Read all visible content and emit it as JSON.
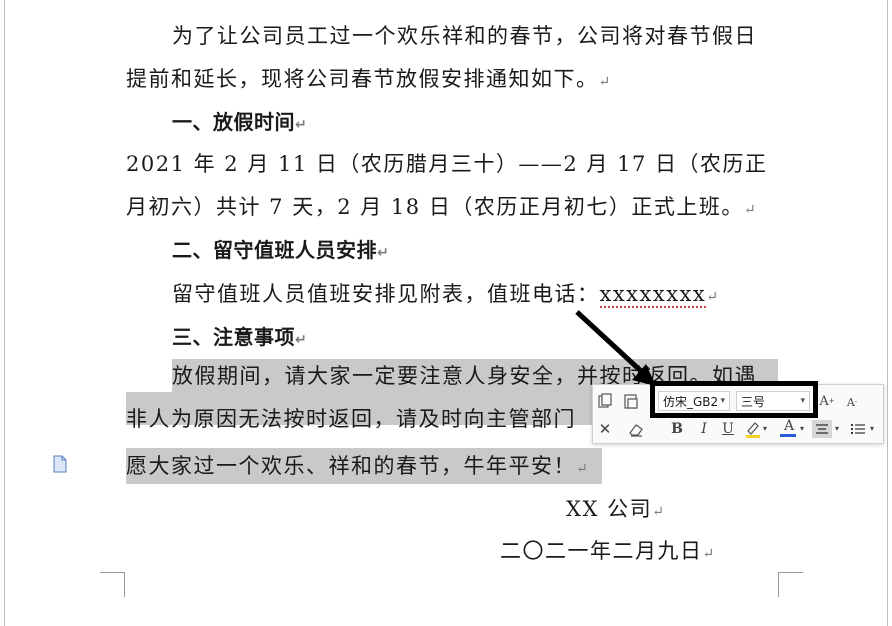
{
  "document": {
    "para1_line1": "为了让公司员工过一个欢乐祥和的春节，公司将对春节假日",
    "para1_line2": "提前和延长，现将公司春节放假安排通知如下。",
    "heading1": "一、放假时间",
    "para2_line1": "2021 年 2 月 11 日（农历腊月三十）——2 月 17 日（农历正",
    "para2_line2": "月初六）共计 7 天，2 月 18 日（农历正月初七）正式上班。",
    "heading2": "二、留守值班人员安排",
    "para3_prefix": "留守值班人员值班安排见附表，值班电话：",
    "para3_phone": "xxxxxxxx",
    "heading3": "三、注意事项",
    "para4_line1": "放假期间，请大家一定要注意人身安全，并按时返回。如遇",
    "para4_line2": "非人为原因无法按时返回，请及时向主管部门",
    "para4_line3": "愿大家过一个欢乐、祥和的春节，牛年平安！",
    "signature_company": "XX 公司",
    "signature_date": "二〇二一年二月九日",
    "paragraph_mark": "↵"
  },
  "toolbar": {
    "font_name": "仿宋_GB2",
    "font_size": "三号",
    "grow_font_label": "A",
    "shrink_font_label": "A",
    "bold_label": "B",
    "italic_label": "I",
    "underline_label": "U",
    "font_color_label": "A",
    "font_color": "#2b5bd7",
    "highlight_color": "#f0d020",
    "dropdown_arrow": "▾"
  },
  "colors": {
    "selection": "#c9c9c9",
    "annotation_box": "#000000",
    "spell_error": "#d04040"
  }
}
